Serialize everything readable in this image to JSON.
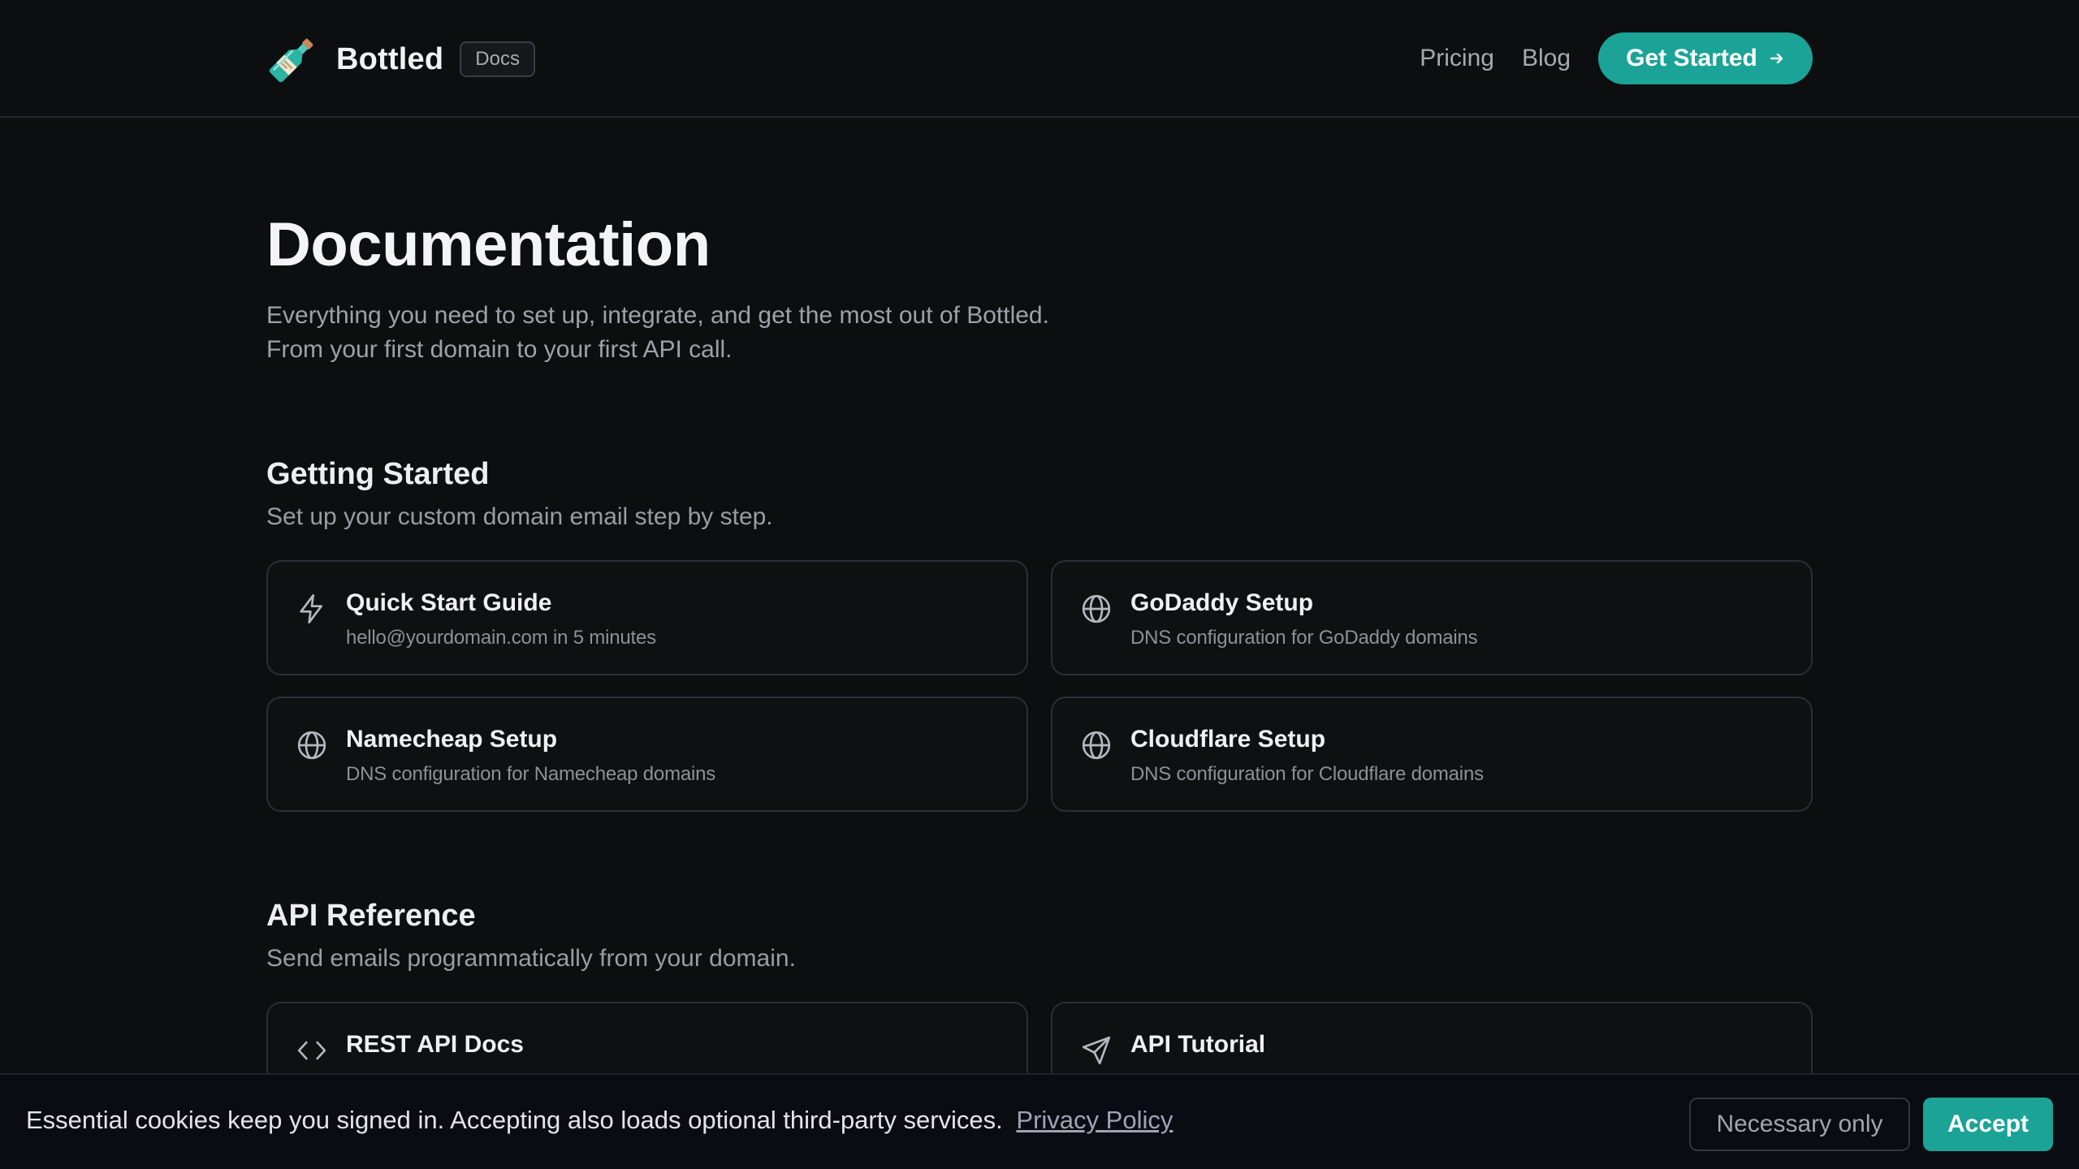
{
  "header": {
    "brand": "Bottled",
    "badge": "Docs",
    "logo_icon": "bottle-icon",
    "nav": [
      {
        "label": "Pricing"
      },
      {
        "label": "Blog"
      }
    ],
    "cta_label": "Get Started",
    "cta_icon": "arrow-right-icon"
  },
  "main": {
    "title": "Documentation",
    "intro_line1": "Everything you need to set up, integrate, and get the most out of Bottled.",
    "intro_line2": "From your first domain to your first API call."
  },
  "sections": [
    {
      "title": "Getting Started",
      "subtitle": "Set up your custom domain email step by step.",
      "cards": [
        {
          "icon": "lightning-icon",
          "title": "Quick Start Guide",
          "desc": "hello@yourdomain.com in 5 minutes"
        },
        {
          "icon": "globe-icon",
          "title": "GoDaddy Setup",
          "desc": "DNS configuration for GoDaddy domains"
        },
        {
          "icon": "globe-icon",
          "title": "Namecheap Setup",
          "desc": "DNS configuration for Namecheap domains"
        },
        {
          "icon": "globe-icon",
          "title": "Cloudflare Setup",
          "desc": "DNS configuration for Cloudflare domains"
        }
      ]
    },
    {
      "title": "API Reference",
      "subtitle": "Send emails programmatically from your domain.",
      "cards": [
        {
          "icon": "code-icon",
          "title": "REST API Docs",
          "desc": ""
        },
        {
          "icon": "send-icon",
          "title": "API Tutorial",
          "desc": ""
        }
      ]
    }
  ],
  "cookie": {
    "text": "Essential cookies keep you signed in. Accepting also loads optional third-party services.",
    "link": "Privacy Policy",
    "necessary_label": "Necessary only",
    "accept_label": "Accept"
  },
  "colors": {
    "background": "#0d0e10",
    "accent": "#1aa396",
    "card_border": "#2c2e33"
  }
}
